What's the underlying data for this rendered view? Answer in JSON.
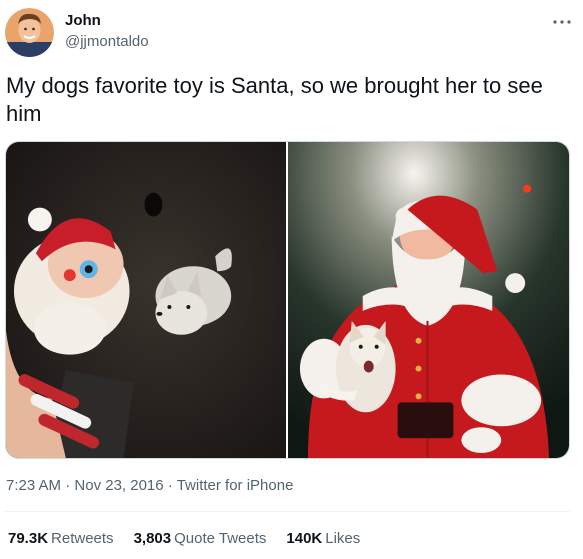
{
  "author": {
    "name": "John",
    "handle": "@jjmontaldo"
  },
  "tweet": {
    "text": "My dogs favorite toy is Santa, so we brought her to see him"
  },
  "meta": {
    "time": "7:23 AM",
    "dot": "·",
    "date": "Nov 23, 2016",
    "source": "Twitter for iPhone"
  },
  "stats": {
    "retweets_count": "79.3K",
    "retweets_label": "Retweets",
    "quote_count": "3,803",
    "quote_label": "Quote Tweets",
    "likes_count": "140K",
    "likes_label": "Likes"
  },
  "colors": {
    "text": "#0f1419",
    "secondary": "#536471",
    "border": "#cfd9de"
  },
  "icons": {
    "more": "more-horizontal-icon"
  }
}
